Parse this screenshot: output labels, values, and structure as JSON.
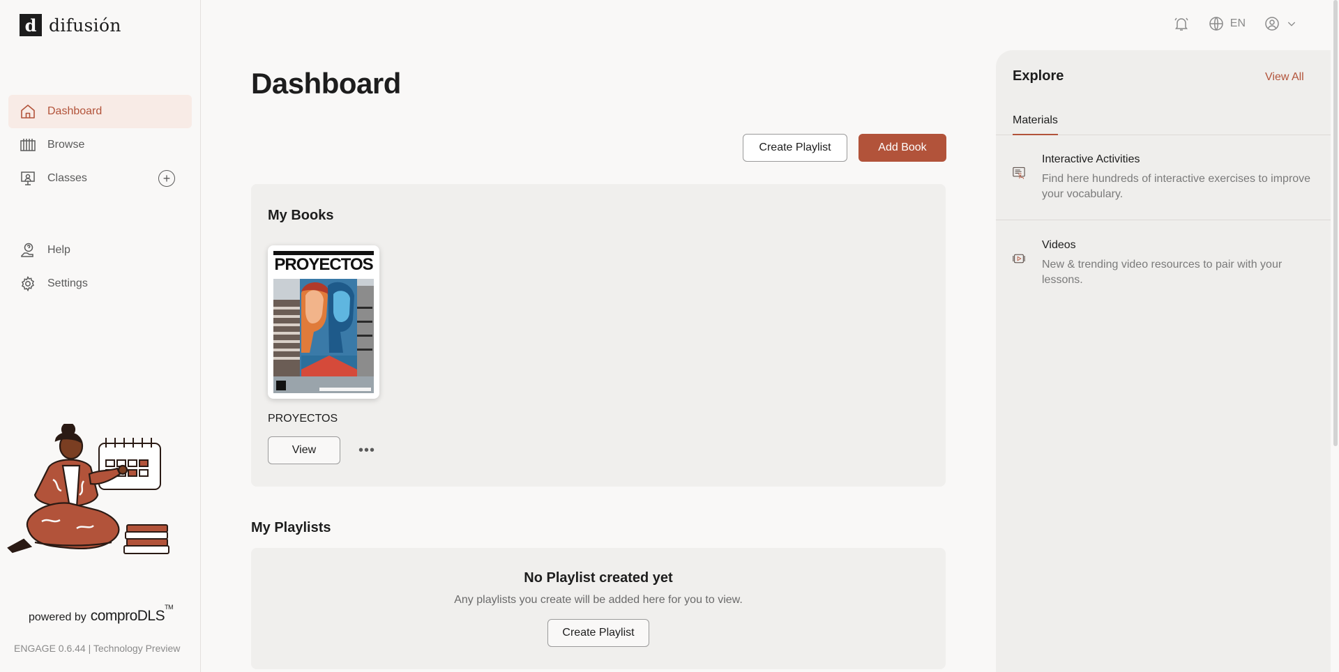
{
  "brand": {
    "logo_letter": "d",
    "name": "difusión"
  },
  "sidebar": {
    "items": [
      {
        "label": "Dashboard",
        "icon": "home-icon",
        "active": true
      },
      {
        "label": "Browse",
        "icon": "browse-icon"
      },
      {
        "label": "Classes",
        "icon": "classes-icon",
        "add_icon": "plus-circle-icon"
      }
    ],
    "secondary": [
      {
        "label": "Help",
        "icon": "help-icon"
      },
      {
        "label": "Settings",
        "icon": "gear-icon"
      }
    ],
    "powered_by_prefix": "powered by",
    "powered_by_brand": "comproDLS",
    "powered_by_tm": "TM",
    "version": "ENGAGE 0.6.44 | Technology Preview"
  },
  "topbar": {
    "notifications_icon": "bell-icon",
    "language_icon": "globe-icon",
    "language": "EN",
    "profile_icon": "user-icon",
    "profile_chevron": "chevron-down-icon"
  },
  "main": {
    "title": "Dashboard",
    "create_playlist_label": "Create Playlist",
    "add_book_label": "Add Book",
    "my_books": {
      "title": "My Books",
      "books": [
        {
          "cover_title": "PROYECTOS",
          "name": "PROYECTOS",
          "view_label": "View",
          "more": "•••"
        }
      ]
    },
    "my_playlists": {
      "title": "My Playlists",
      "empty_title": "No Playlist created yet",
      "empty_desc": "Any playlists you create will be added here for you to view.",
      "create_label": "Create Playlist"
    }
  },
  "explore": {
    "title": "Explore",
    "view_all": "View All",
    "tabs": [
      {
        "label": "Materials",
        "active": true
      }
    ],
    "items": [
      {
        "title": "Interactive Activities",
        "desc": "Find here hundreds of interactive exercises to improve your vocabulary.",
        "icon": "interactive-activities-icon"
      },
      {
        "title": "Videos",
        "desc": "New & trending video resources to pair with your lessons.",
        "icon": "video-icon"
      }
    ]
  },
  "colors": {
    "accent": "#b2533a",
    "active_bg": "#f8ebe6",
    "panel_bg": "#f0efed",
    "page_bg": "#f9f8f7"
  }
}
